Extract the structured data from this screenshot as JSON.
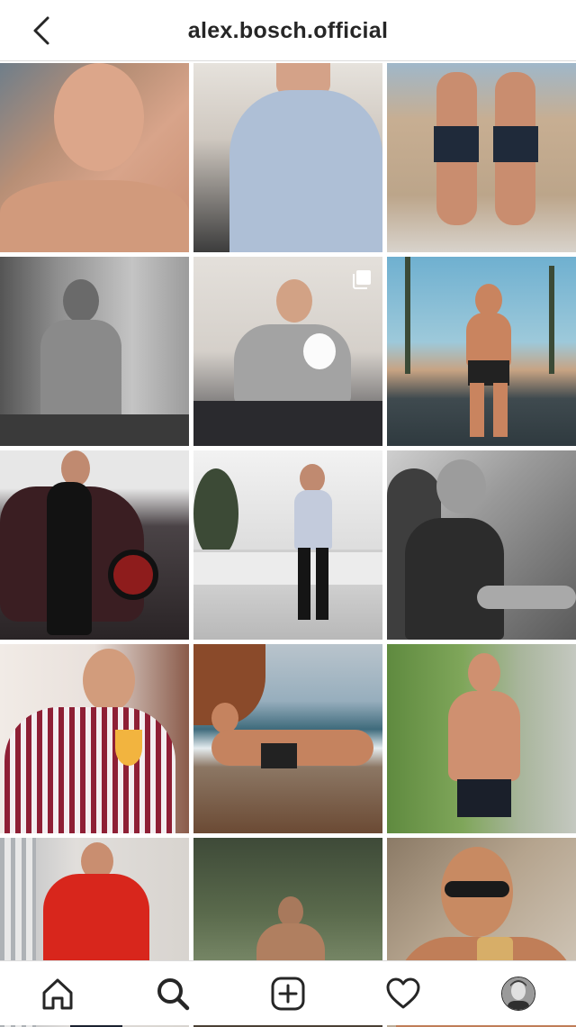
{
  "header": {
    "username": "alex.bosch.official",
    "back_icon": "chevron-left-icon"
  },
  "grid": {
    "posts": [
      {
        "scene": "close-up selfie on knit blanket",
        "bg": "#b88f76",
        "fg": "#d7a184"
      },
      {
        "scene": "man in light blue shirt at desk",
        "bg": "#c9cfd6",
        "fg": "#8fa7c6"
      },
      {
        "scene": "two men in shorts by stone wall",
        "bg": "#c9b9a2",
        "fg": "#1f2a3a"
      },
      {
        "scene": "mirror selfie in bathroom",
        "bg": "#9a9a9a",
        "fg": "#5f5f5f"
      },
      {
        "scene": "man on sofa holding small white dog",
        "bg": "#d8d4ce",
        "fg": "#9b9b9b"
      },
      {
        "scene": "shirtless man on palm-lined road",
        "bg": "#7eb3c9",
        "fg": "#c9845f"
      },
      {
        "scene": "man in black beside red-rim car",
        "bg": "#3a3334",
        "fg": "#101010"
      },
      {
        "scene": "man on white stone staircase",
        "bg": "#d7d8da",
        "fg": "#1c1c1c"
      },
      {
        "scene": "man in sunglasses in convertible",
        "bg": "#8a8a8a",
        "fg": "#2c2c2c"
      },
      {
        "scene": "man in striped shirt with cocktail",
        "bg": "#e9e1dc",
        "fg": "#8e1f35"
      },
      {
        "scene": "man lying on beach shore",
        "bg": "#a6b3bd",
        "fg": "#6b4a34"
      },
      {
        "scene": "shirtless man on garden path",
        "bg": "#6f9a4e",
        "fg": "#c98c6a"
      },
      {
        "scene": "man in red puffer jacket",
        "bg": "#d6d3cf",
        "fg": "#d8261c"
      },
      {
        "scene": "shirtless man in forest",
        "bg": "#5a6a4c",
        "fg": "#a8795c"
      },
      {
        "scene": "selfie with mojito and sunglasses",
        "bg": "#b5a48e",
        "fg": "#c88a62"
      }
    ],
    "multi_icon": "carousel-icon"
  },
  "tabbar": {
    "home_icon": "home-icon",
    "search_icon": "search-icon",
    "add_icon": "add-post-icon",
    "activity_icon": "heart-icon",
    "profile_icon": "avatar"
  }
}
